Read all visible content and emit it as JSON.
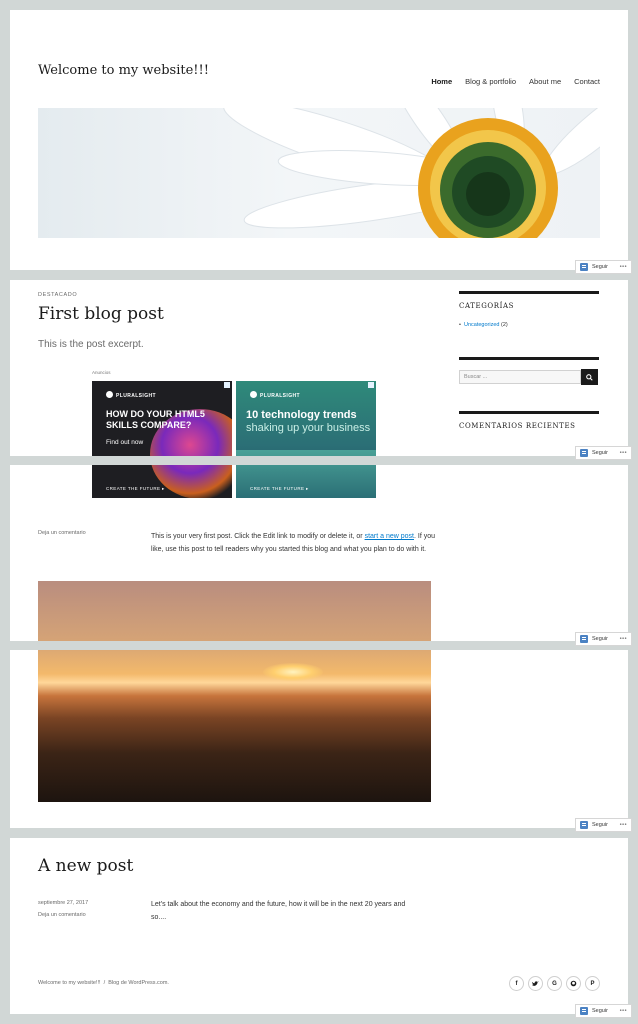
{
  "header": {
    "site_title": "Welcome to my website!!!",
    "nav": [
      "Home",
      "Blog & portfolio",
      "About me",
      "Contact"
    ],
    "active_nav": "Home"
  },
  "featured_post": {
    "kicker": "DESTACADO",
    "title": "First blog post",
    "excerpt": "This is the post excerpt.",
    "ads_label": "Anuncios",
    "ads": [
      {
        "brand": "PLURALSIGHT",
        "headline": "HOW DO YOUR HTML5 SKILLS COMPARE?",
        "subline": "Find out now",
        "cta": "CREATE THE FUTURE ▸"
      },
      {
        "brand": "PLURALSIGHT",
        "headline_bold": "10 technology trends",
        "headline_light": " shaking up your business",
        "cta": "CREATE THE FUTURE ▸"
      }
    ],
    "meta_comment": "Deja un comentario",
    "body_before_link": "This is your very first post. Click the Edit link to modify or delete it, or ",
    "body_link": "start a new post",
    "body_after_link": ". If you like, use this post to tell readers why you started this blog and what you plan to do with it."
  },
  "sidebar": {
    "categories_title": "CATEGORÍAS",
    "category_name": "Uncategorized",
    "category_count": " (2)",
    "search_placeholder": "Buscar ...",
    "recent_comments_title": "COMENTARIOS RECIENTES"
  },
  "second_post": {
    "title": "A new post",
    "date": "septiembre 27, 2017",
    "comment_link": "Deja un comentario",
    "text": "Let's talk about the economy and the future, how it will be in the next 20 years and so...."
  },
  "footer": {
    "site_link": "Welcome to my website!!!",
    "separator": "/",
    "credit": "Blog de WordPress.com.",
    "social_icons": [
      "facebook-icon",
      "twitter-icon",
      "google-plus-icon",
      "github-icon",
      "pinterest-icon"
    ]
  },
  "follow": {
    "label": "Seguir",
    "more": "•••"
  }
}
